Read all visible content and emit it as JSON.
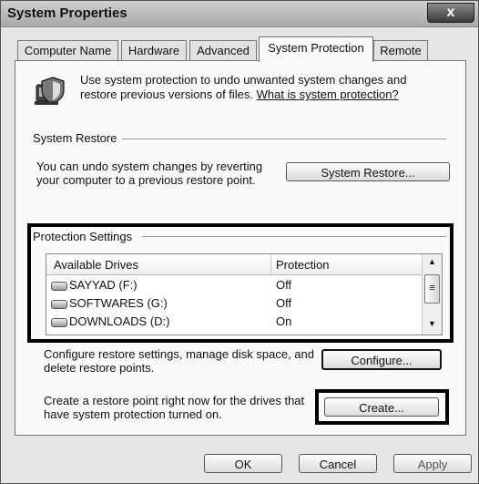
{
  "window": {
    "title": "System Properties",
    "close_glyph": "x"
  },
  "tabs": [
    "Computer Name",
    "Hardware",
    "Advanced",
    "System Protection",
    "Remote"
  ],
  "intro": {
    "text": "Use system protection to undo unwanted system changes and restore previous versions of files.",
    "link": "What is system protection?"
  },
  "system_restore": {
    "heading": "System Restore",
    "text": "You can undo system changes by reverting your computer to a previous restore point.",
    "button": "System Restore..."
  },
  "protection": {
    "heading": "Protection Settings",
    "columns": [
      "Available Drives",
      "Protection"
    ],
    "drives": [
      {
        "name": "SAYYAD (F:)",
        "protection": "Off"
      },
      {
        "name": "SOFTWARES (G:)",
        "protection": "Off"
      },
      {
        "name": "DOWNLOADS (D:)",
        "protection": "On"
      }
    ],
    "configure_text": "Configure restore settings, manage disk space, and delete restore points.",
    "configure_button": "Configure...",
    "create_text": "Create a restore point right now for the drives that have system protection turned on.",
    "create_button": "Create..."
  },
  "buttons": {
    "ok": "OK",
    "cancel": "Cancel",
    "apply": "Apply"
  },
  "icons": {
    "shield": "shield-icon",
    "drive": "drive-icon"
  },
  "colors": {
    "highlight_border": "#000000",
    "titlebar": "#b8b8b8"
  }
}
